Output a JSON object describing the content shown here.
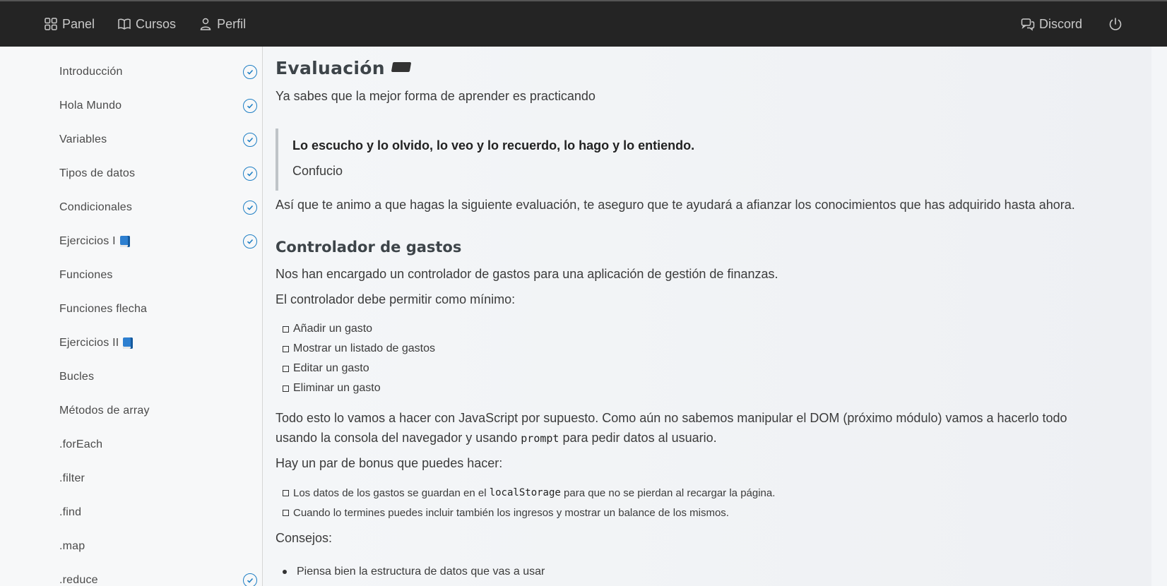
{
  "nav": {
    "items": [
      {
        "label": "Panel",
        "icon": "grid-icon"
      },
      {
        "label": "Cursos",
        "icon": "book-open-icon"
      },
      {
        "label": "Perfil",
        "icon": "user-icon"
      }
    ],
    "discord_label": "Discord",
    "power_icon": "power-icon"
  },
  "sidebar": {
    "items": [
      {
        "label": "Introducción",
        "done": true
      },
      {
        "label": "Hola Mundo",
        "done": true
      },
      {
        "label": "Variables",
        "done": true
      },
      {
        "label": "Tipos de datos",
        "done": true
      },
      {
        "label": "Condicionales",
        "done": true
      },
      {
        "label": "Ejercicios I",
        "done": true,
        "book": true
      },
      {
        "label": "Funciones",
        "done": false
      },
      {
        "label": "Funciones flecha",
        "done": false
      },
      {
        "label": "Ejercicios II",
        "done": false,
        "book": true
      },
      {
        "label": "Bucles",
        "done": false
      },
      {
        "label": "Métodos de array",
        "done": false
      },
      {
        "label": ".forEach",
        "done": false
      },
      {
        "label": ".filter",
        "done": false
      },
      {
        "label": ".find",
        "done": false
      },
      {
        "label": ".map",
        "done": false
      },
      {
        "label": ".reduce",
        "done": true
      }
    ]
  },
  "content": {
    "title": "Evaluación",
    "intro": "Ya sabes que la mejor forma de aprender es practicando",
    "quote_text": "Lo escucho y lo olvido, lo veo y lo recuerdo, lo hago y lo entiendo.",
    "quote_author": "Confucio",
    "para1": "Así que te animo a que hagas la siguiente evaluación, te aseguro que te ayudará a afianzar los conocimientos que has adquirido hasta ahora.",
    "section_title": "Controlador de gastos",
    "para2": "Nos han encargado un controlador de gastos para una aplicación de gestión de finanzas.",
    "para3": "El controlador debe permitir como mínimo:",
    "requirements": [
      "Añadir un gasto",
      "Mostrar un listado de gastos",
      "Editar un gasto",
      "Eliminar un gasto"
    ],
    "para4_a": "Todo esto lo vamos a hacer con JavaScript por supuesto. Como aún no sabemos manipular el DOM (próximo módulo) vamos a hacerlo todo",
    "para4_b": "usando la consola del navegador y usando",
    "para4_code": "prompt",
    "para4_c": "para pedir datos al usuario.",
    "para5": "Hay un par de bonus que puedes hacer:",
    "bonus1_a": "Los datos de los gastos se guardan en el",
    "bonus1_code": "localStorage",
    "bonus1_b": "para que no se pierdan al recargar la página.",
    "bonus2": "Cuando lo termines puedes incluir también los ingresos y mostrar un balance de los mismos.",
    "tips_title": "Consejos:",
    "tips": [
      "Piensa bien la estructura de datos que vas a usar"
    ]
  }
}
